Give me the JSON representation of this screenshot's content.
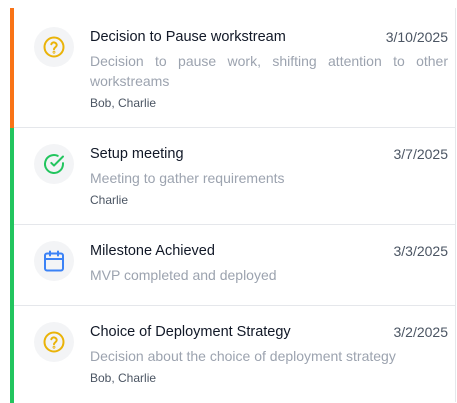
{
  "colors": {
    "accent_orange": "#f97316",
    "accent_green": "#22c55e",
    "icon_yellow": "#eab308",
    "icon_green": "#22c55e",
    "icon_blue": "#3b82f6"
  },
  "items": [
    {
      "title": "Decision to Pause workstream",
      "date": "3/10/2025",
      "description": "Decision to pause work, shifting attention to other workstreams",
      "people": "Bob, Charlie",
      "icon": "question-circle-icon",
      "accent": "#f97316"
    },
    {
      "title": "Setup meeting",
      "date": "3/7/2025",
      "description": "Meeting to gather requirements",
      "people": "Charlie",
      "icon": "check-circle-icon",
      "accent": "#22c55e"
    },
    {
      "title": "Milestone Achieved",
      "date": "3/3/2025",
      "description": "MVP completed and deployed",
      "people": "",
      "icon": "calendar-icon",
      "accent": "#22c55e"
    },
    {
      "title": "Choice of Deployment Strategy",
      "date": "3/2/2025",
      "description": "Decision about the choice of deployment strategy",
      "people": "Bob, Charlie",
      "icon": "question-circle-icon",
      "accent": "#22c55e"
    }
  ]
}
